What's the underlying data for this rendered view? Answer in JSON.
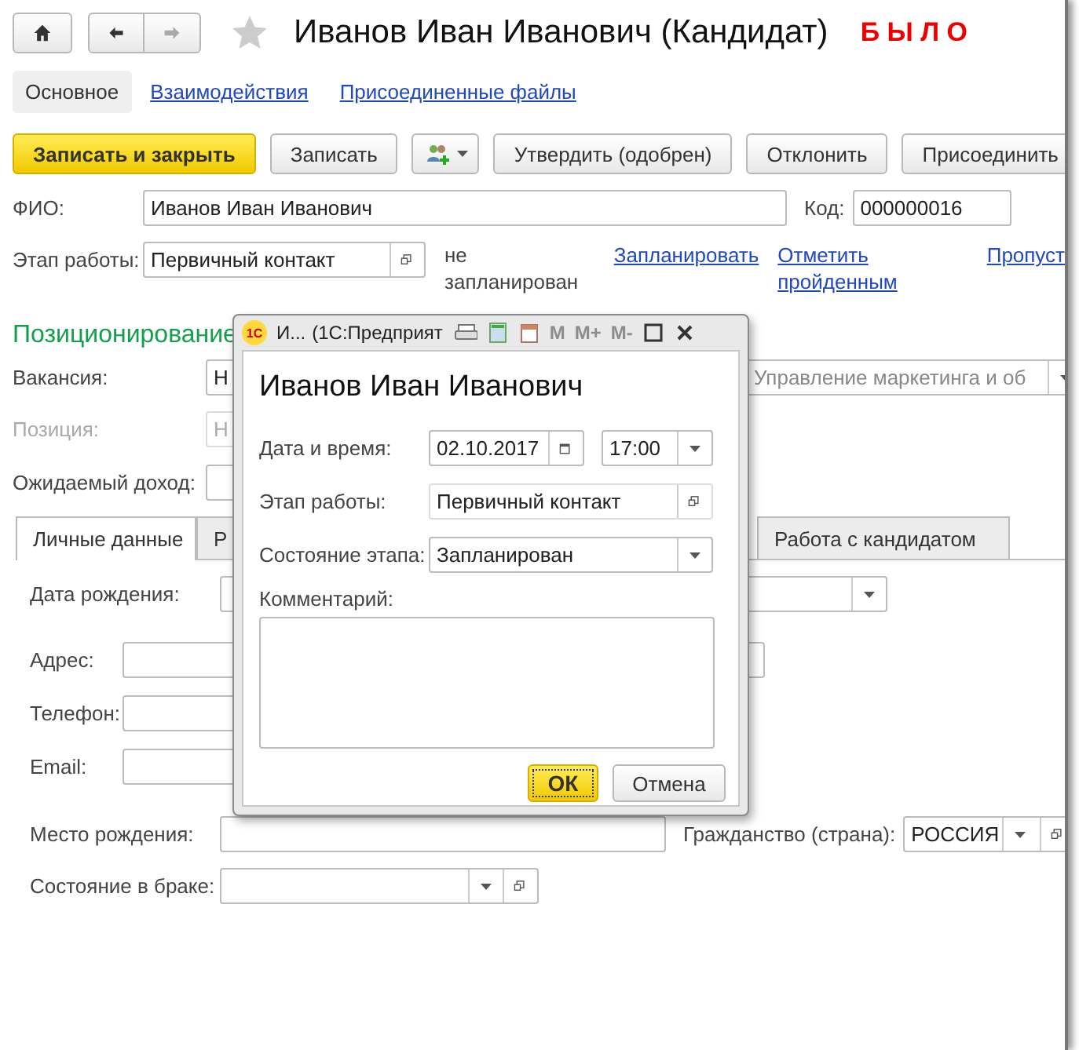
{
  "header": {
    "title": "Иванов Иван Иванович (Кандидат)",
    "stamp": "Б Ы Л О",
    "favorite": false
  },
  "sections": [
    {
      "label": "Основное",
      "selected": true
    },
    {
      "label": "Взаимодействия",
      "selected": false
    },
    {
      "label": "Присоединенные файлы",
      "selected": false
    }
  ],
  "actions": [
    {
      "kind": "primary",
      "label": "Записать и закрыть"
    },
    {
      "kind": "plain",
      "label": "Записать"
    },
    {
      "kind": "icon-menu"
    },
    {
      "kind": "plain",
      "label": "Утвердить (одобрен)"
    },
    {
      "kind": "plain",
      "label": "Отклонить"
    },
    {
      "kind": "plain",
      "label": "Присоединить"
    }
  ],
  "fio": {
    "label": "ФИО:",
    "value": "Иванов Иван Иванович"
  },
  "code": {
    "label": "Код:",
    "value": "000000016"
  },
  "stage": {
    "label": "Этап работы:",
    "value": "Первичный контакт",
    "status": "не запланирован",
    "links": [
      "Запланировать",
      "Отметить пройденным",
      "Пропуст"
    ]
  },
  "positioning": {
    "heading": "Позиционирование",
    "vacancy": {
      "label": "Вакансия:",
      "value": "Н",
      "department": "Управление маркетинга и об"
    },
    "position": {
      "label": "Позиция:",
      "value": "Н",
      "disabled": true
    },
    "income": {
      "label": "Ожидаемый доход:"
    }
  },
  "tabs": [
    {
      "label": "Личные данные",
      "selected": true
    },
    {
      "label": "Р",
      "selected": false
    },
    {
      "label": "Работа с кандидатом",
      "selected": false
    }
  ],
  "personal": {
    "birth_date": {
      "label": "Дата рождения:"
    },
    "address": {
      "label": "Адрес:"
    },
    "phone": {
      "label": "Телефон:"
    },
    "email": {
      "label": "Email:"
    },
    "birth_place": {
      "label": "Место рождения:"
    },
    "citizenship": {
      "label": "Гражданство (страна):",
      "value": "РОССИЯ"
    },
    "marital": {
      "label": "Состояние в браке:"
    }
  },
  "dialog": {
    "logo": "1С",
    "caption": "И...",
    "app": "(1С:Предприят",
    "memory": [
      {
        "label": "M",
        "disabled": true
      },
      {
        "label": "M+",
        "disabled": true
      },
      {
        "label": "M-",
        "disabled": true
      }
    ],
    "heading": "Иванов Иван Иванович",
    "date": {
      "label": "Дата и время:",
      "value": "02.10.2017",
      "time": "17:00"
    },
    "stage": {
      "label": "Этап работы:",
      "value": "Первичный контакт"
    },
    "state": {
      "label": "Состояние этапа:",
      "value": "Запланирован"
    },
    "comment": {
      "label": "Комментарий:"
    },
    "buttons": [
      {
        "kind": "default",
        "label": "ОК"
      },
      {
        "kind": "plain",
        "label": "Отмена"
      }
    ]
  }
}
